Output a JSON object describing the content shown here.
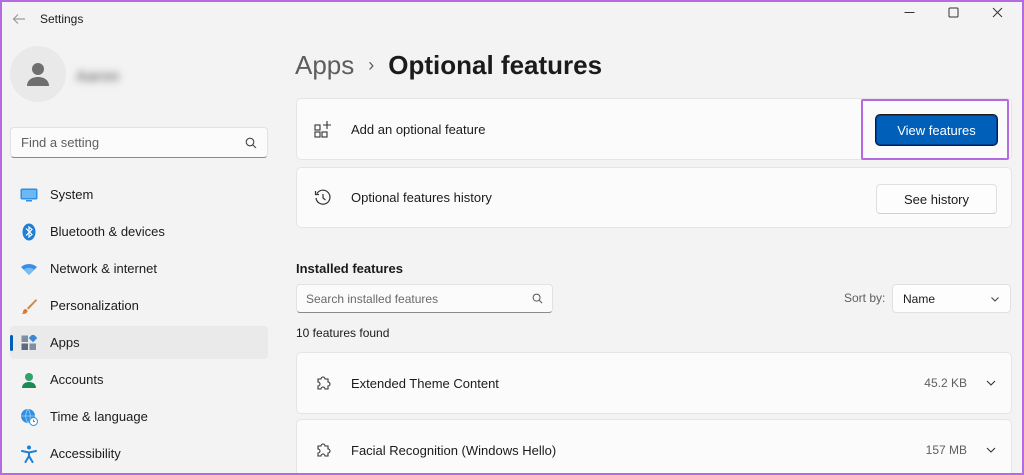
{
  "window": {
    "app_title": "Settings",
    "controls": {
      "minimize": "—",
      "maximize": "☐",
      "close": "✕"
    }
  },
  "sidebar": {
    "user_name": "Aaron",
    "search": {
      "placeholder": "Find a setting"
    },
    "items": [
      {
        "label": "System",
        "icon": "monitor-icon",
        "active": false
      },
      {
        "label": "Bluetooth & devices",
        "icon": "bluetooth-icon",
        "active": false
      },
      {
        "label": "Network & internet",
        "icon": "wifi-icon",
        "active": false
      },
      {
        "label": "Personalization",
        "icon": "brush-icon",
        "active": false
      },
      {
        "label": "Apps",
        "icon": "apps-icon",
        "active": true
      },
      {
        "label": "Accounts",
        "icon": "person-icon",
        "active": false
      },
      {
        "label": "Time & language",
        "icon": "globe-clock-icon",
        "active": false
      },
      {
        "label": "Accessibility",
        "icon": "accessibility-icon",
        "active": false
      }
    ]
  },
  "breadcrumb": {
    "parent": "Apps",
    "separator": "›",
    "current": "Optional features"
  },
  "cards": {
    "add_feature": {
      "label": "Add an optional feature",
      "button": "View features",
      "icon": "add-grid-icon"
    },
    "history": {
      "label": "Optional features history",
      "button": "See history",
      "icon": "history-icon"
    }
  },
  "installed": {
    "title": "Installed features",
    "search_placeholder": "Search installed features",
    "sort_label": "Sort by:",
    "sort_value": "Name",
    "count_text": "10 features found",
    "features": [
      {
        "name": "Extended Theme Content",
        "size": "45.2 KB",
        "icon": "puzzle-icon"
      },
      {
        "name": "Facial Recognition (Windows Hello)",
        "size": "157 MB",
        "icon": "puzzle-icon"
      }
    ]
  },
  "colors": {
    "accent": "#005fb8",
    "highlight": "#b46ae0",
    "background": "#f3f3f3",
    "card": "#fbfbfb"
  }
}
